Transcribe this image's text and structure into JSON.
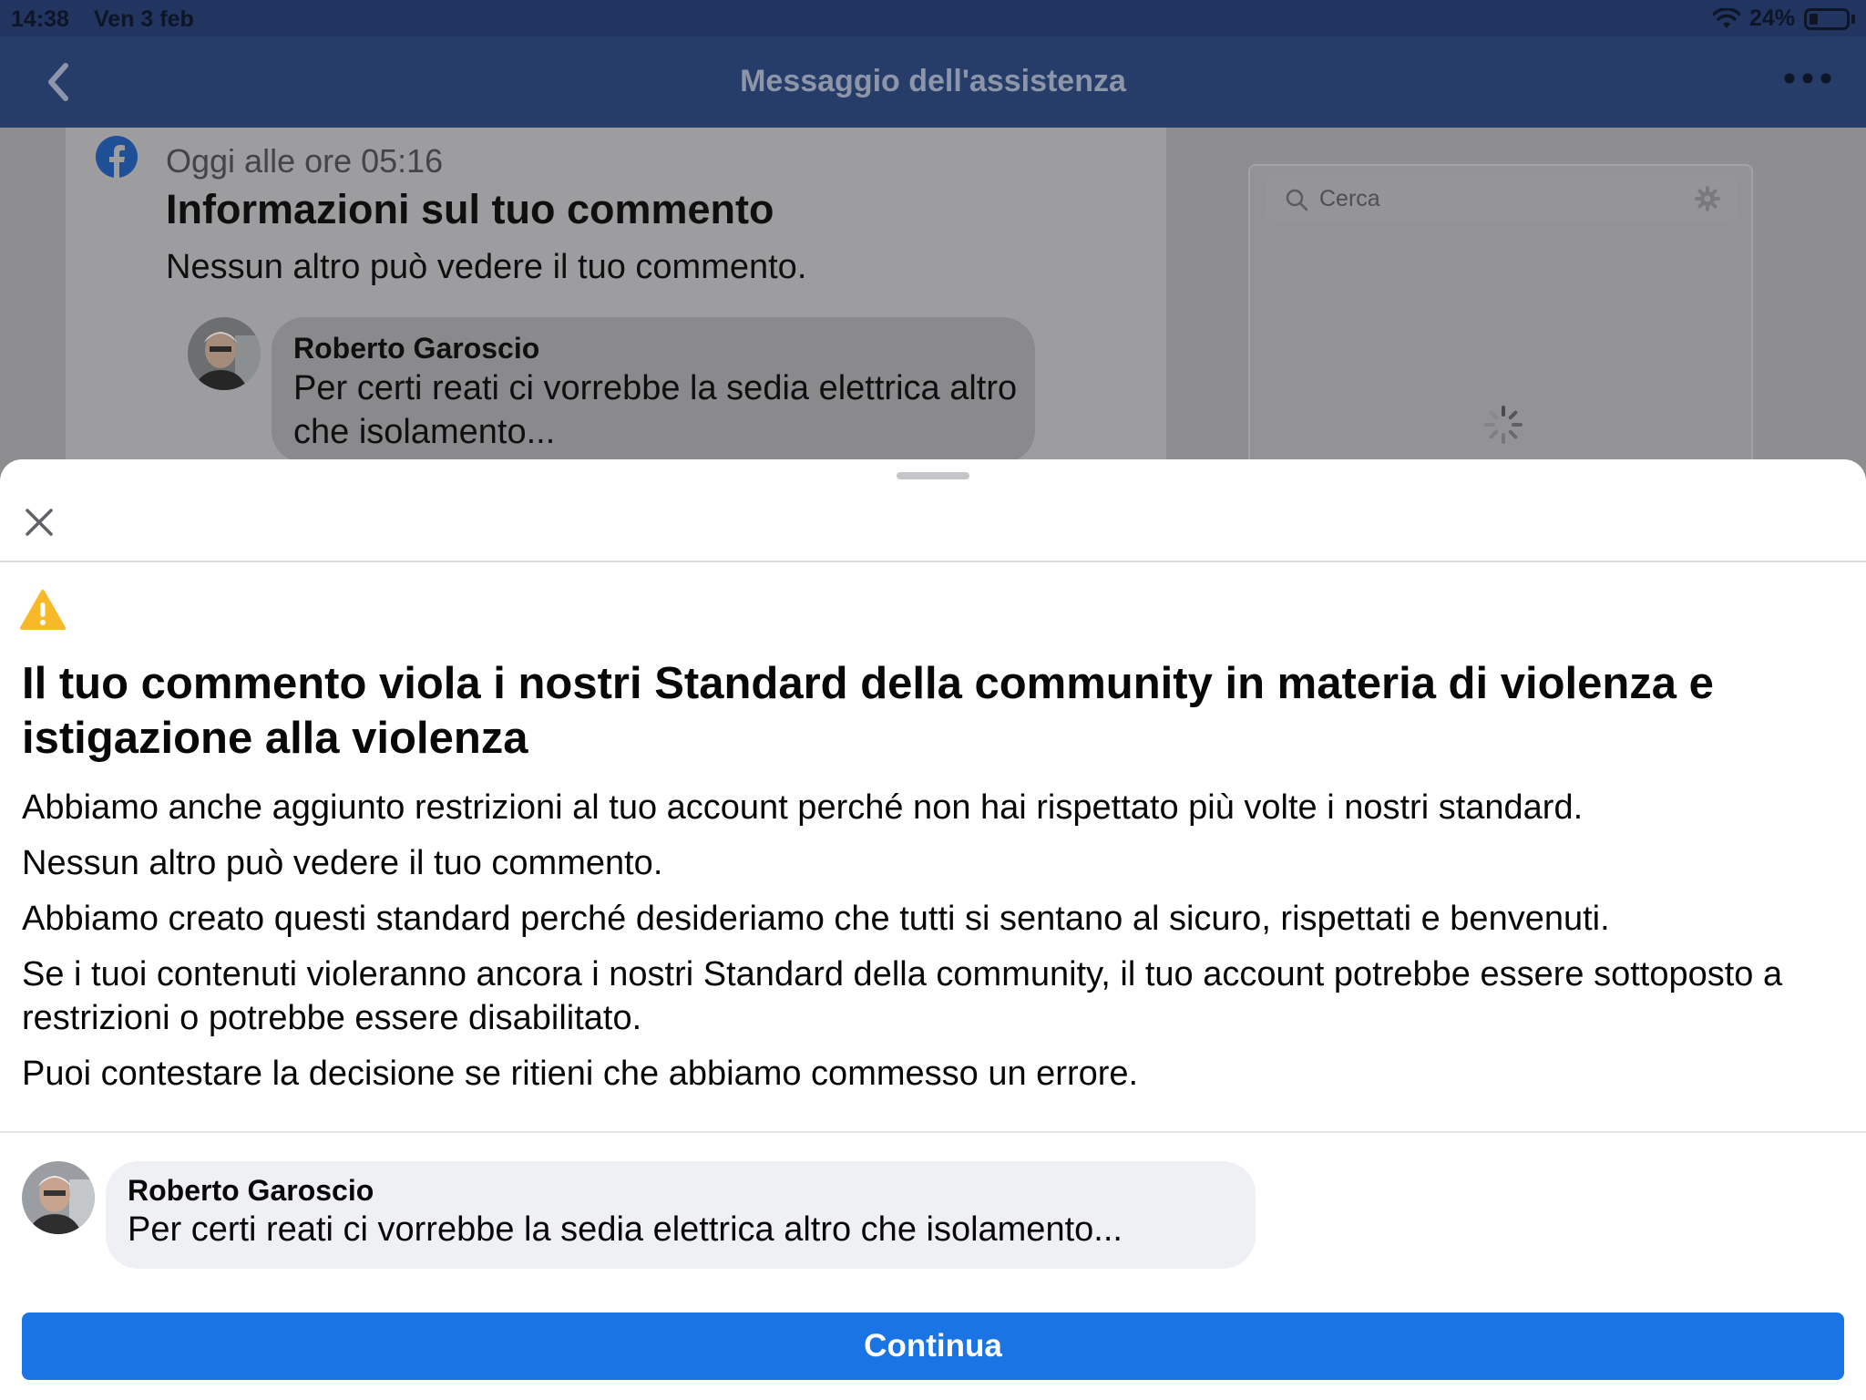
{
  "status_bar": {
    "time": "14:38",
    "date": "Ven 3 feb",
    "battery": "24%",
    "battery_level": 0.24,
    "icons": [
      "wifi-icon",
      "battery-icon"
    ]
  },
  "nav": {
    "title": "Messaggio dell'assistenza",
    "icons": [
      "chevron-left-icon",
      "more-icon"
    ]
  },
  "background_message": {
    "timestamp": "Oggi alle ore 05:16",
    "title": "Informazioni sul tuo commento",
    "subtitle": "Nessun altro può vedere il tuo commento.",
    "comment": {
      "author": "Roberto Garoscio",
      "text": "Per certi reati ci vorrebbe la sedia elettrica altro che isolamento..."
    }
  },
  "side_panel": {
    "search_placeholder": "Cerca",
    "icons": [
      "search-icon",
      "gear-icon",
      "spinner-icon"
    ]
  },
  "sheet": {
    "title": "Il tuo commento viola i nostri Standard della community in materia di violenza e istigazione alla violenza",
    "paragraphs": [
      "Abbiamo anche aggiunto restrizioni al tuo account perché non hai rispettato più volte i nostri standard.",
      "Nessun altro può vedere il tuo commento.",
      "Abbiamo creato questi standard perché desideriamo che tutti si sentano al sicuro, rispettati e benvenuti.",
      "Se i tuoi contenuti violeranno ancora i nostri Standard della community, il tuo account potrebbe essere sottoposto a restrizioni o potrebbe essere disabilitato.",
      "Puoi contestare la decisione se ritieni che abbiamo commesso un errore."
    ],
    "comment": {
      "author": "Roberto Garoscio",
      "text": "Per certi reati ci vorrebbe la sedia elettrica altro che isolamento..."
    },
    "continue_label": "Continua",
    "icons": [
      "close-icon",
      "warning-icon"
    ]
  },
  "colors": {
    "nav_bg": "#263c69",
    "primary_button": "#1b74e4",
    "warning": "#f7b928",
    "bubble_bg": "#eff0f3"
  }
}
